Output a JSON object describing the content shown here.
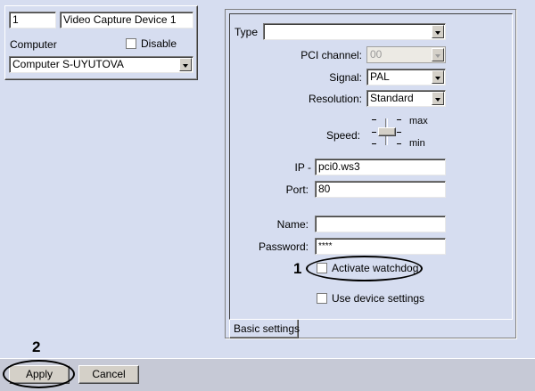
{
  "device": {
    "id": "1",
    "name": "Video Capture Device 1",
    "computer_label": "Computer",
    "disable_label": "Disable",
    "computer_value": "Computer S-UYUTOVA"
  },
  "settings": {
    "type_label": "Type",
    "type_value": "",
    "pci_label": "PCI channel:",
    "pci_value": "00",
    "signal_label": "Signal:",
    "signal_value": "PAL",
    "resolution_label": "Resolution:",
    "resolution_value": "Standard",
    "speed_label": "Speed:",
    "speed_max": "max",
    "speed_min": "min",
    "ip_label": "IP -",
    "ip_value": "pci0.ws3",
    "port_label": "Port:",
    "port_value": "80",
    "name_label": "Name:",
    "name_value": "",
    "password_label": "Password:",
    "password_value": "****",
    "watchdog_label": "Activate watchdog",
    "device_settings_label": "Use device settings",
    "tab_label": "Basic settings"
  },
  "callouts": {
    "one": "1",
    "two": "2"
  },
  "footer": {
    "apply_label": "Apply",
    "cancel_label": "Cancel"
  }
}
